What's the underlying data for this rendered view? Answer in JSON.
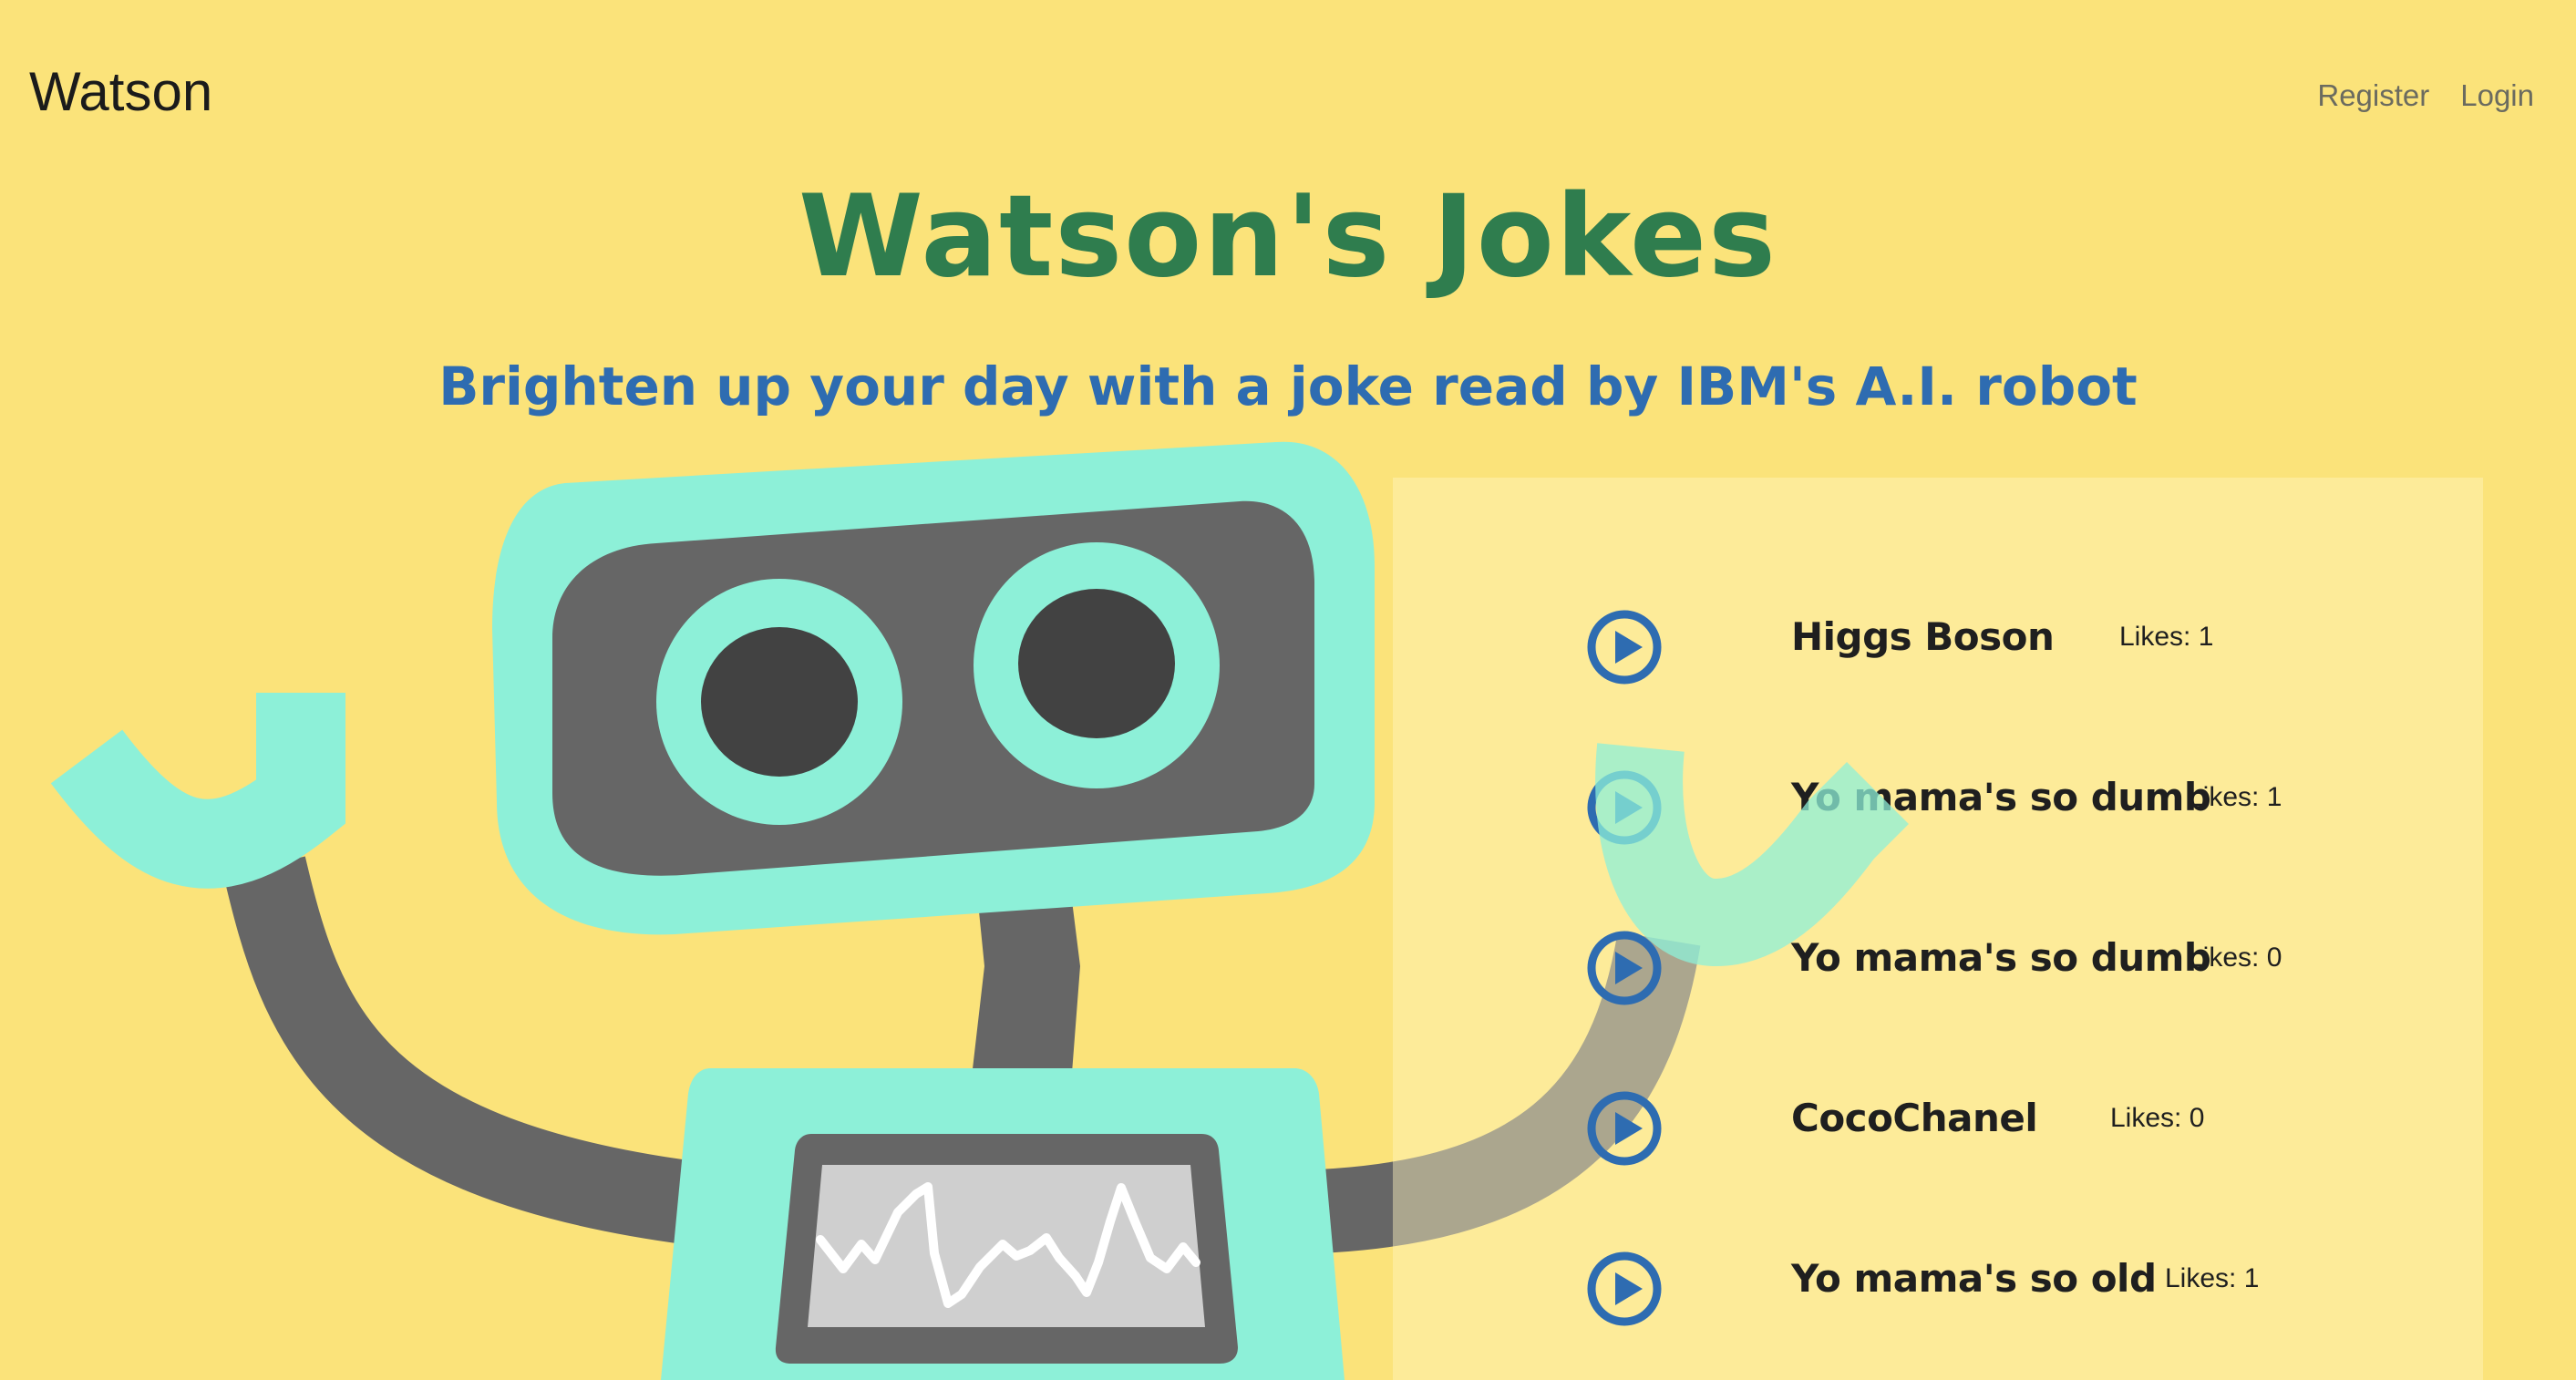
{
  "nav": {
    "brand": "Watson",
    "links": [
      "Register",
      "Login"
    ]
  },
  "hero": {
    "title": "Watson's Jokes",
    "subtitle": "Brighten up your day with a joke read by IBM's A.I. robot"
  },
  "jokes": [
    {
      "title": "Higgs Boson",
      "likes": "Likes: 1"
    },
    {
      "title": "Yo mama's so dumb",
      "likes": "Likes: 1"
    },
    {
      "title": "Yo mama's so dumb",
      "likes": "Likes: 0"
    },
    {
      "title": "CocoChanel",
      "likes": "Likes: 0"
    },
    {
      "title": "Yo mama's so old",
      "likes": "Likes: 1"
    }
  ],
  "colors": {
    "background": "#fbe37a",
    "title": "#2f7d4e",
    "subtitle": "#2e6cb1",
    "play_icon": "#2e6cb1",
    "robot_mint": "#8df0d8",
    "robot_gray": "#666666"
  },
  "icons": {
    "play": "play-circle-icon"
  }
}
